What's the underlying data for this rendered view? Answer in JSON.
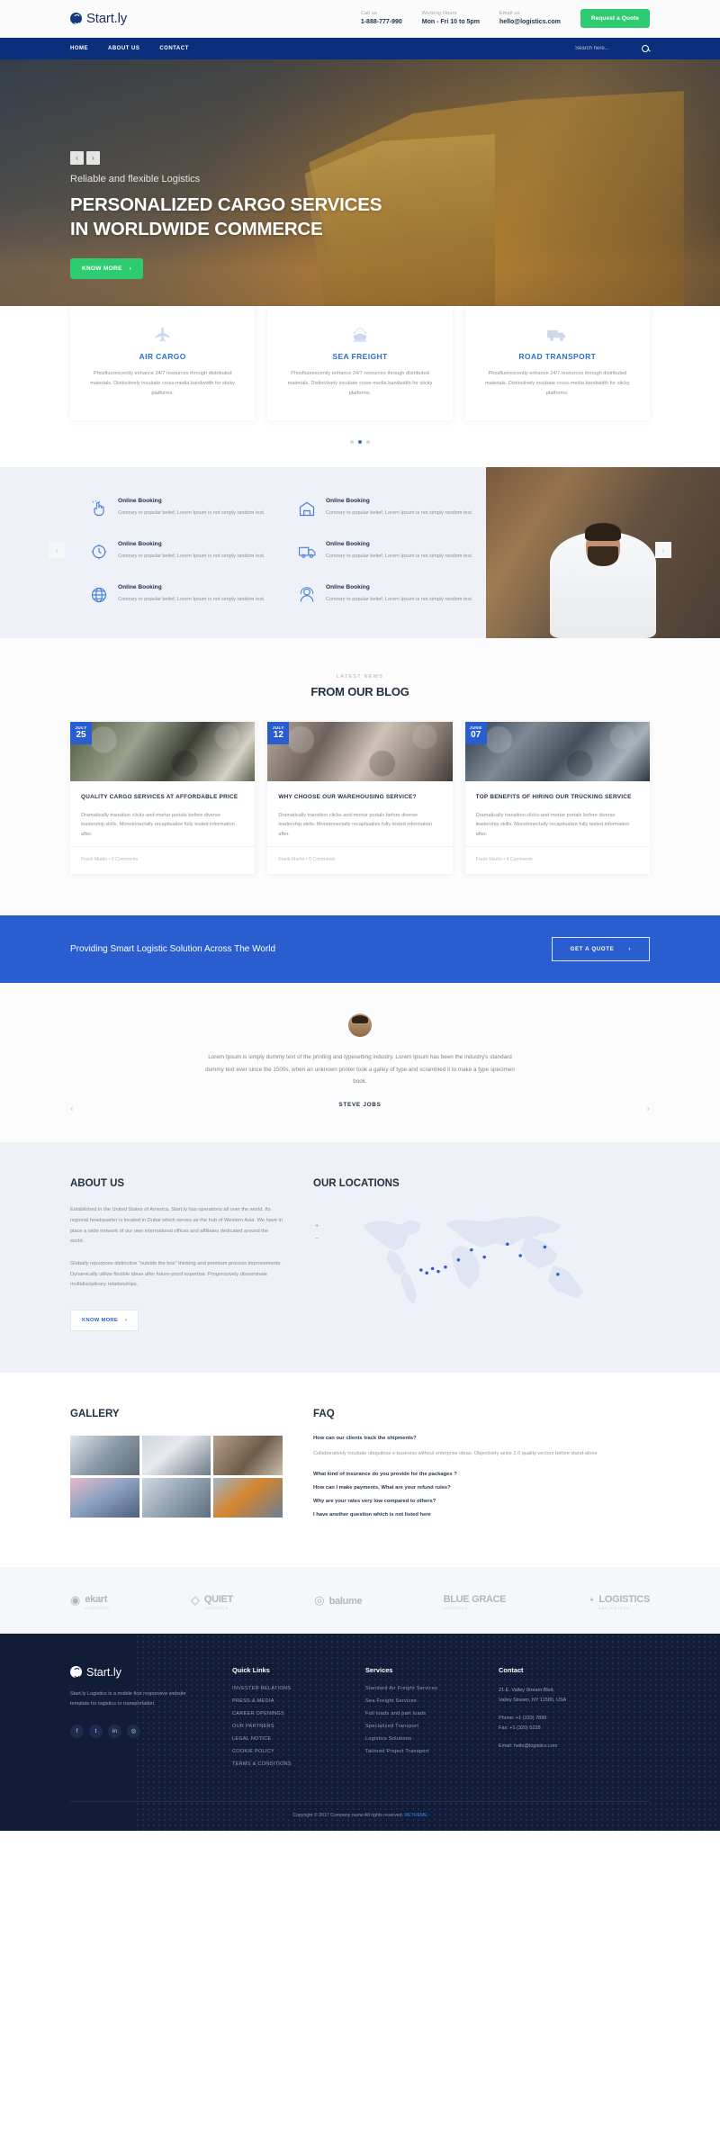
{
  "topbar": {
    "brand": "Start.ly",
    "info": [
      {
        "label": "Call us",
        "value": "1-888-777-990"
      },
      {
        "label": "Working Hours",
        "value": "Mon - Fri 10 to 5pm"
      },
      {
        "label": "Email us",
        "value": "hello@logistics.com"
      }
    ],
    "quote_button": "Request a Quote"
  },
  "nav": {
    "items": [
      "HOME",
      "ABOUT US",
      "CONTACT"
    ],
    "search_placeholder": "Search here...",
    "search_value": ""
  },
  "hero": {
    "prev": "‹",
    "next": "›",
    "subtitle": "Reliable and flexible Logistics",
    "title_line1": "PERSONALIZED CARGO SERVICES",
    "title_line2": "IN WORLDWIDE COMMERCE",
    "button": "KNOW MORE",
    "button_arrow": "›",
    "side_prev": "‹",
    "side_next": "›"
  },
  "services": {
    "cards": [
      {
        "icon": "airplane-icon",
        "title": "AIR CARGO",
        "desc": "Phosfluorescently enhance 24/7 resources through distributed materials. Distinctively incubate cross-media bandwidth for sticky platforms."
      },
      {
        "icon": "ship-icon",
        "title": "SEA FREIGHT",
        "desc": "Phosfluorescently enhance 24/7 resources through distributed materials. Distinctively incubate cross-media bandwidth for sticky platforms."
      },
      {
        "icon": "truck-icon",
        "title": "ROAD TRANSPORT",
        "desc": "Phosfluorescently enhance 24/7 resources through distributed materials. Distinctively incubate cross-media bandwidth for sticky platforms."
      }
    ],
    "dots": 3,
    "active_dot": 1
  },
  "features": {
    "items": [
      {
        "icon": "click-hand-icon",
        "title": "Online Booking",
        "text": "Contrary to popular belief, Lorem Ipsum is not simply random text."
      },
      {
        "icon": "warehouse-icon",
        "title": "Online Booking",
        "text": "Contrary to popular belief, Lorem Ipsum is not simply random text."
      },
      {
        "icon": "tracking-icon",
        "title": "Online Booking",
        "text": "Contrary to popular belief, Lorem Ipsum is not simply random text."
      },
      {
        "icon": "delivery-truck-icon",
        "title": "Online Booking",
        "text": "Contrary to popular belief, Lorem Ipsum is not simply random text."
      },
      {
        "icon": "globe-icon",
        "title": "Online Booking",
        "text": "Contrary to popular belief, Lorem Ipsum is not simply random text."
      },
      {
        "icon": "support-agent-icon",
        "title": "Online Booking",
        "text": "Contrary to popular belief, Lorem Ipsum is not simply random text."
      }
    ]
  },
  "blog": {
    "eyebrow": "LATEST NEWS",
    "title": "FROM OUR BLOG",
    "posts": [
      {
        "month": "JULY",
        "day": "25",
        "title": "QUALITY CARGO SERVICES AT AFFORDABLE PRICE",
        "text": "Dramatically transition clicks-and-mortar portals before diverse leadership skills. Monotonectally recaptiualize fully tested information after.",
        "meta": "Frank Martin  •  0 Comments"
      },
      {
        "month": "JULY",
        "day": "12",
        "title": "WHY CHOOSE OUR WAREHOUSING SERVICE?",
        "text": "Dramatically transition clicks-and-mortar portals before diverse leadership skills. Monotonectally recaptiualize fully tested information after.",
        "meta": "Frank Martin  •  0 Comments"
      },
      {
        "month": "JUNE",
        "day": "07",
        "title": "TOP BENEFITS OF HIRING OUR TRUCKING SERVICE",
        "text": "Dramatically transition clicks-and-mortar portals before diverse leadership skills. Monotonectally recaptiualize fully tested information after.",
        "meta": "Frank Martin  •  4 Comments"
      }
    ]
  },
  "cta": {
    "text": "Providing Smart Logistic Solution Across The World",
    "button": "GET A QUOTE",
    "button_arrow": "›"
  },
  "testimonial": {
    "quote": "Lorem Ipsum is simply dummy text of the printing and typesetting industry. Lorem Ipsum has been the industry's standard dummy text ever since the 1500s, when an unknown printer took a galley of type and scrambled it to make a type specimen book.",
    "author": "STEVE JOBS",
    "prev": "‹",
    "next": "›"
  },
  "about": {
    "title": "ABOUT US",
    "paragraphs": [
      "Established in the United States of America, Start.ly has operations all over the world. Its regional headquarter is located in Dubai which serves as the hub of Western Asia. We have in place a wide network of our own international offices and affiliates dedicated around the world.",
      "Globally repurpose distinctive \"outside the box\" thinking and premium process improvements. Dynamically utilize flexible ideas after future-proof expertise. Progressively disseminate multidisciplinary relationships."
    ],
    "button": "KNOW MORE",
    "button_arrow": "›"
  },
  "locations": {
    "title": "OUR LOCATIONS",
    "zoom_in": "+",
    "zoom_out": "−"
  },
  "gallery": {
    "title": "GALLERY"
  },
  "faq": {
    "title": "FAQ",
    "items": [
      {
        "q": "How can our clients track the shipments?",
        "a": "Collaboratively incubate ubiquitous e-business without enterprise ideas. Objectively seize 2.0 quality vectors before stand-alone"
      },
      {
        "q": "What kind of insurance do you provide for the packages ?",
        "a": ""
      },
      {
        "q": "How can I make payments, What are your refund rules?",
        "a": ""
      },
      {
        "q": "Why are your rates very low compared to others?",
        "a": ""
      },
      {
        "q": "I have another question which is not listed here",
        "a": ""
      }
    ]
  },
  "partners": [
    {
      "mark": "◉",
      "name": "ekart",
      "sub": "LOGISTICS"
    },
    {
      "mark": "◇",
      "name": "QUIET",
      "sub": "LOGISTICS"
    },
    {
      "mark": "◎",
      "name": "balume",
      "sub": ""
    },
    {
      "mark": "",
      "name": "BLUE GRACE",
      "sub": "LOGISTICS"
    },
    {
      "mark": "◔",
      "name": "LOGISTICS",
      "sub": "AND FINTECH"
    }
  ],
  "footer": {
    "brand": "Start.ly",
    "about": "Start.ly Logistics is a mobile first responsive website template for logistics or transportation.",
    "socials": [
      "f",
      "t",
      "in",
      "◎"
    ],
    "columns": [
      {
        "title": "Quick Links",
        "links": [
          "INVESTER RELATIONS",
          "PRESS & MEDIA",
          "CAREER OPENINGS",
          "OUR PARTNERS",
          "LEGAL NOTICE",
          "COOKIE POLICY",
          "TERMS & CONDITIONS"
        ]
      },
      {
        "title": "Services",
        "links": [
          "Standard Air Freight Services",
          "Sea Freight Services",
          "Full loads and part loads",
          "Specialized Transport",
          "Logistics Solutions",
          "Tailored Project Transport"
        ]
      }
    ],
    "contact": {
      "title": "Contact",
      "address_line1": "21 E. Valley Stream Blvd,",
      "address_line2": "Valley Stream, NY 11580, USA",
      "phone": "Phone:  +1 (233) 7899",
      "fax": "Fax:  +1 (320) 5228",
      "email": "Email:   hello@logistics.com"
    },
    "copyright_pre": "Copyright © 2017 Company name All rights reserved.",
    "copyright_link": "RETHEME"
  }
}
